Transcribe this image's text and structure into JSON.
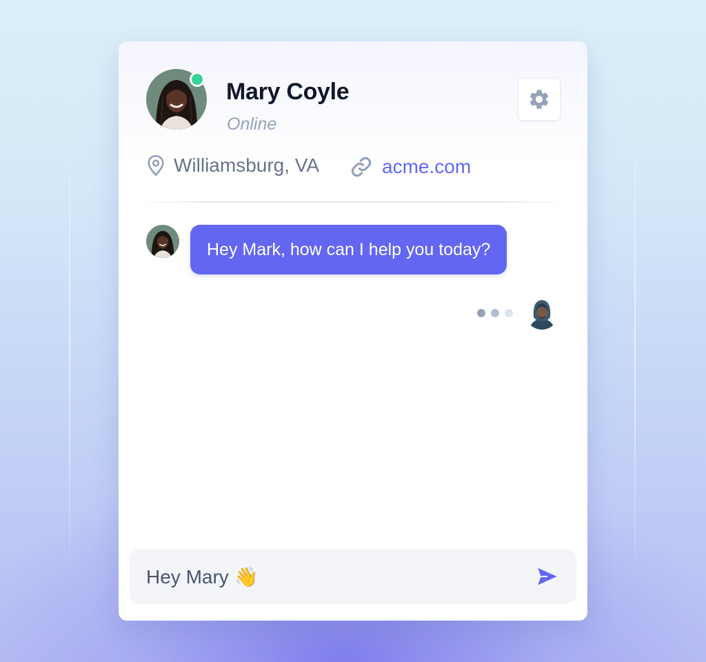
{
  "contact": {
    "name": "Mary Coyle",
    "status": "Online",
    "location": "Williamsburg, VA",
    "website": "acme.com",
    "avatar_icon": "woman-portrait-avatar"
  },
  "settings": {
    "icon": "gear-icon"
  },
  "messages": [
    {
      "sender": "Mary Coyle",
      "text": "Hey Mark, how can I help you today?"
    }
  ],
  "typing_indicator": {
    "dot_count": 3
  },
  "current_user": {
    "avatar_icon": "hooded-man-avatar"
  },
  "composer": {
    "value": "Hey Mary 👋",
    "send_icon": "send-icon"
  },
  "colors": {
    "accent": "#6366f1",
    "online": "#34d399",
    "name_text": "#0f172a",
    "muted_text": "#94a3b8",
    "body_text": "#64748b",
    "composer_bg": "#f4f5f9"
  }
}
